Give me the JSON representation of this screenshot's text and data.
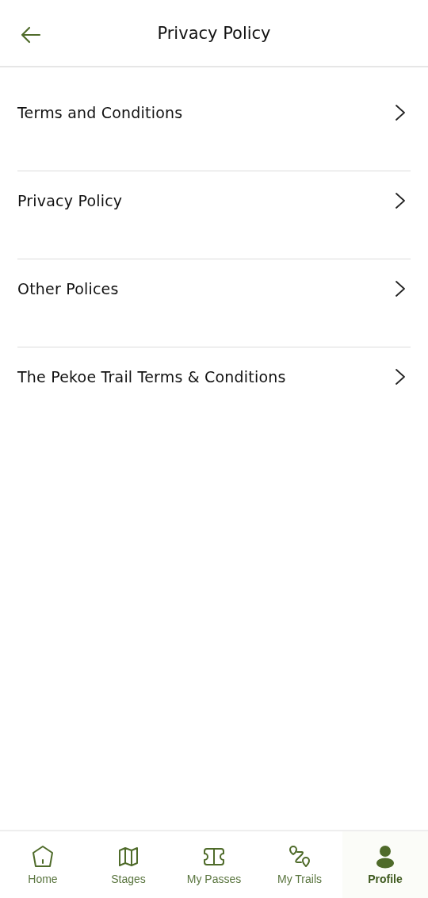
{
  "header": {
    "title": "Privacy Policy"
  },
  "items": [
    {
      "label": "Terms and Conditions"
    },
    {
      "label": "Privacy Policy"
    },
    {
      "label": "Other Polices"
    },
    {
      "label": "The Pekoe Trail Terms & Conditions"
    }
  ],
  "nav": [
    {
      "kind": "home",
      "label": "Home",
      "selected": false
    },
    {
      "kind": "map",
      "label": "Stages",
      "selected": false
    },
    {
      "kind": "ticket",
      "label": "My Passes",
      "selected": false
    },
    {
      "kind": "route",
      "label": "My Trails",
      "selected": false
    },
    {
      "kind": "person",
      "label": "Profile",
      "selected": true
    }
  ]
}
